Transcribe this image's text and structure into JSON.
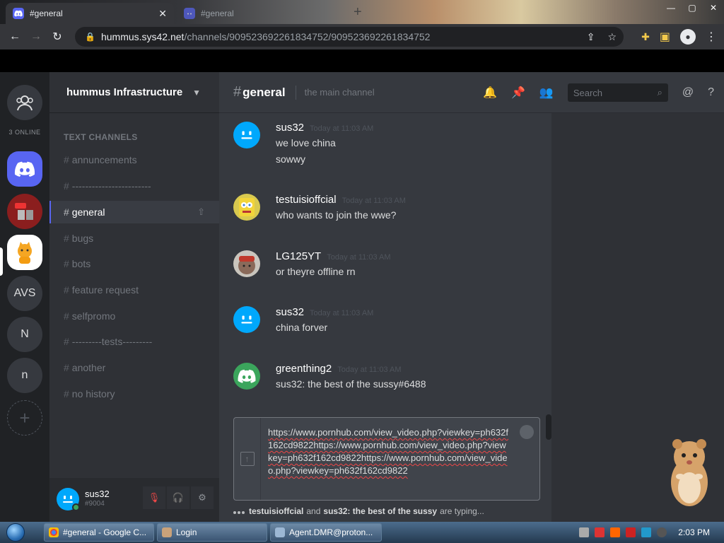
{
  "browser": {
    "tabs": [
      {
        "title": "#general",
        "active": true
      },
      {
        "title": "#general",
        "active": false
      }
    ],
    "url_host": "hummus.sys42.net",
    "url_path": "/channels/909523692261834752/909523692261834752"
  },
  "server": {
    "name": "hummus Infrastructure",
    "online_count": "3 ONLINE",
    "guilds": [
      "AVS",
      "N",
      "n"
    ]
  },
  "channels": {
    "category": "TEXT CHANNELS",
    "items": [
      {
        "name": "annuncements",
        "active": false
      },
      {
        "name": "------------------------",
        "active": false
      },
      {
        "name": "general",
        "active": true
      },
      {
        "name": "bugs",
        "active": false
      },
      {
        "name": "bots",
        "active": false
      },
      {
        "name": "feature request",
        "active": false
      },
      {
        "name": "selfpromo",
        "active": false
      },
      {
        "name": "---------tests---------",
        "active": false
      },
      {
        "name": "another",
        "active": false
      },
      {
        "name": "no history",
        "active": false
      }
    ]
  },
  "user": {
    "name": "sus32",
    "tag": "#9004"
  },
  "header": {
    "channel": "general",
    "topic": "the main channel",
    "search_placeholder": "Search"
  },
  "messages": [
    {
      "author": "sus32",
      "time": "Today at 11:03 AM",
      "lines": [
        "we love china",
        "sowwy"
      ],
      "avatar": "blue"
    },
    {
      "author": "testuisioffcial",
      "time": "Today at 11:03 AM",
      "lines": [
        "who wants to join the wwe?"
      ],
      "avatar": "sponge"
    },
    {
      "author": "LG125YT",
      "time": "Today at 11:03 AM",
      "lines": [
        "or theyre offline rn"
      ],
      "avatar": "red"
    },
    {
      "author": "sus32",
      "time": "Today at 11:03 AM",
      "lines": [
        "china forver"
      ],
      "avatar": "blue"
    },
    {
      "author": "greenthing2",
      "time": "Today at 11:03 AM",
      "lines": [
        "sus32: the best of the sussy#6488"
      ],
      "avatar": "green"
    }
  ],
  "composer": {
    "text": "https://www.pornhub.com/view_video.php?viewkey=ph632f162cd9822https://www.pornhub.com/view_video.php?viewkey=ph632f162cd9822https://www.pornhub.com/view_video.php?viewkey=ph632f162cd9822"
  },
  "typing": {
    "user1": "testuisioffcial",
    "and": "and",
    "user2": "sus32: the best of the sussy",
    "suffix": "are typing..."
  },
  "taskbar": {
    "items": [
      "#general - Google C...",
      "Login",
      "Agent.DMR@proton..."
    ],
    "clock": "2:03 PM"
  },
  "colors": {
    "blurple": "#5865f2",
    "bg_main": "#36393f",
    "bg_sidebar": "#2f3136",
    "bg_guilds": "#202225"
  }
}
